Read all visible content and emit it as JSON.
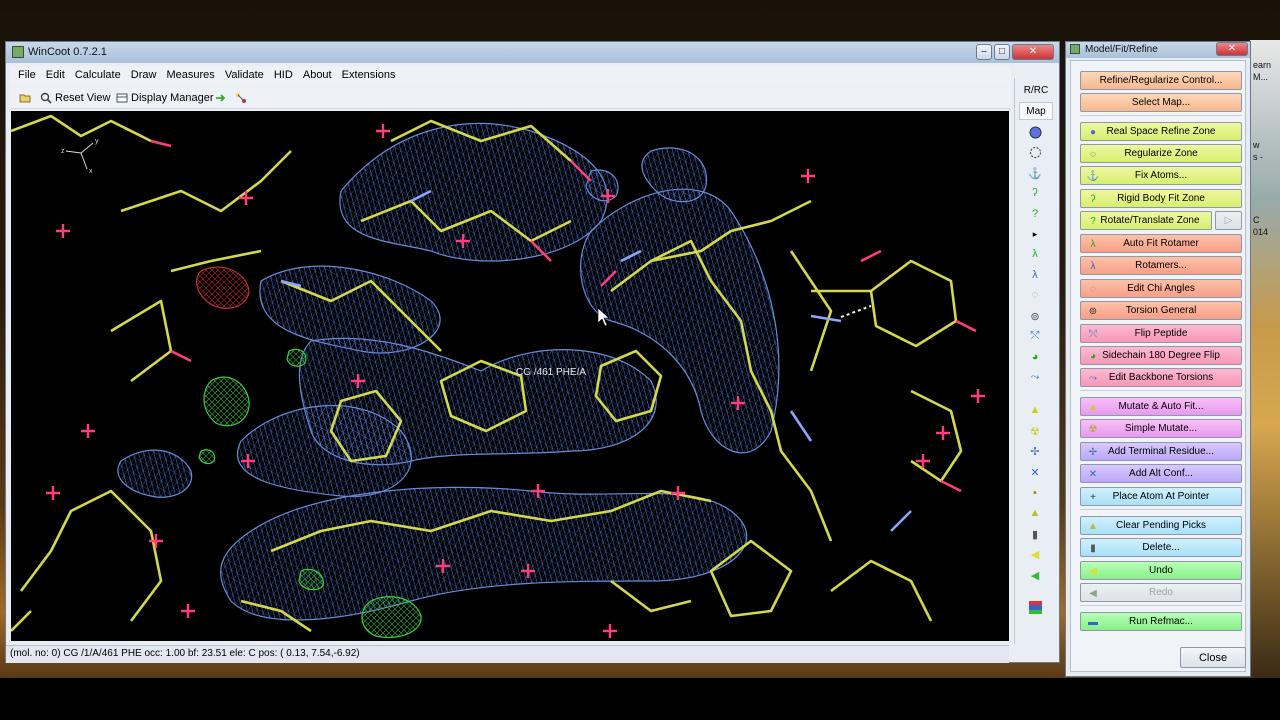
{
  "main_window": {
    "title": "WinCoot 0.7.2.1",
    "menu": [
      "File",
      "Edit",
      "Calculate",
      "Draw",
      "Measures",
      "Validate",
      "HID",
      "About",
      "Extensions"
    ],
    "toolbar": {
      "reset_view": "Reset View",
      "display_manager": "Display Manager"
    },
    "atom_label": "CG /461 PHE/A",
    "status": "(mol. no: 0)  CG /1/A/461 PHE occ:  1.00 bf: 23.51 ele:  C pos: ( 0.13, 7.54,-6.92)",
    "right_toolbar": {
      "rrc": "R/RC",
      "map": "Map"
    }
  },
  "model_fit_refine": {
    "title": "Model/Fit/Refine",
    "buttons": [
      {
        "label": "Refine/Regularize Control...",
        "color": "orange",
        "icon": ""
      },
      {
        "label": "Select Map...",
        "color": "orange",
        "icon": ""
      },
      {
        "label": "Real Space Refine Zone",
        "color": "lime",
        "icon": "sphere-icon"
      },
      {
        "label": "Regularize Zone",
        "color": "lime",
        "icon": "dashed-circle-icon"
      },
      {
        "label": "Fix Atoms...",
        "color": "lime",
        "icon": "anchor-icon"
      },
      {
        "label": "Rigid Body Fit Zone",
        "color": "lime",
        "icon": "rigid-body-icon"
      },
      {
        "label": "Rotate/Translate Zone",
        "color": "lime",
        "icon": "rotate-translate-icon"
      },
      {
        "label": "Auto Fit Rotamer",
        "color": "salmon",
        "icon": "rotamer-icon"
      },
      {
        "label": "Rotamers...",
        "color": "salmon",
        "icon": "rotamers-icon"
      },
      {
        "label": "Edit Chi Angles",
        "color": "salmon",
        "icon": "chi-angles-icon"
      },
      {
        "label": "Torsion General",
        "color": "salmon",
        "icon": "torsion-icon"
      },
      {
        "label": "Flip Peptide",
        "color": "pink",
        "icon": "flip-peptide-icon"
      },
      {
        "label": "Sidechain 180 Degree Flip",
        "color": "pink",
        "icon": "sidechain-flip-icon"
      },
      {
        "label": "Edit Backbone Torsions",
        "color": "pink",
        "icon": "backbone-torsion-icon"
      },
      {
        "label": "Mutate & Auto Fit...",
        "color": "magenta",
        "icon": "mutate-autofit-icon"
      },
      {
        "label": "Simple Mutate...",
        "color": "magenta",
        "icon": "mutate-icon"
      },
      {
        "label": "Add Terminal Residue...",
        "color": "lav",
        "icon": "terminal-residue-icon"
      },
      {
        "label": "Add Alt Conf...",
        "color": "lav",
        "icon": "alt-conf-icon"
      },
      {
        "label": "Place Atom At Pointer",
        "color": "cyan",
        "icon": "place-atom-icon"
      },
      {
        "label": "Clear Pending Picks",
        "color": "cyan",
        "icon": "clear-picks-icon"
      },
      {
        "label": "Delete...",
        "color": "cyan",
        "icon": "trash-icon"
      },
      {
        "label": "Undo",
        "color": "green",
        "icon": "undo-icon"
      },
      {
        "label": "Redo",
        "color": "grey",
        "icon": "redo-icon"
      },
      {
        "label": "Run Refmac...",
        "color": "green",
        "icon": "refmac-icon"
      }
    ],
    "close": "Close"
  },
  "desktop_text": [
    "earn",
    "M...",
    "w",
    "s -",
    "C",
    "014"
  ]
}
